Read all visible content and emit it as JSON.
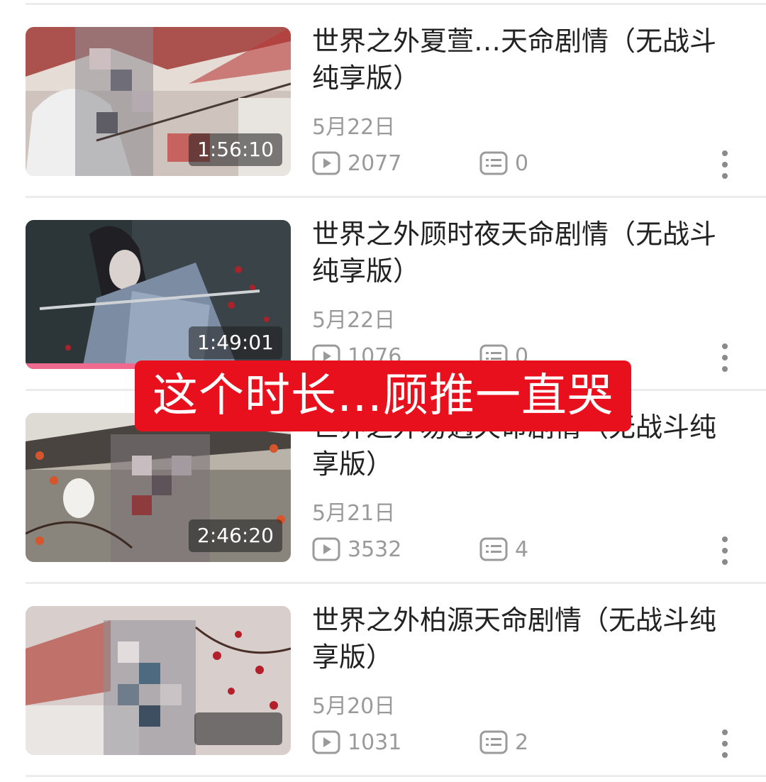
{
  "videos": [
    {
      "title": "世界之外夏萱…天命剧情（无战斗纯享版）",
      "duration": "1:56:10",
      "date": "5月22日",
      "views": "2077",
      "comments": "0",
      "progress": 0
    },
    {
      "title": "世界之外顾时夜天命剧情（无战斗纯享版）",
      "duration": "1:49:01",
      "date": "5月22日",
      "views": "1076",
      "comments": "0",
      "progress": 0.5
    },
    {
      "title": "世界之外易遇天命剧情（无战斗纯享版）",
      "duration": "2:46:20",
      "date": "5月21日",
      "views": "3532",
      "comments": "4",
      "progress": 0
    },
    {
      "title": "世界之外柏源天命剧情（无战斗纯享版）",
      "duration": "",
      "date": "5月20日",
      "views": "1031",
      "comments": "2",
      "progress": 0
    }
  ],
  "overlay_caption": "这个时长…顾推一直哭",
  "icons": {
    "views": "play-icon",
    "comments": "comment-icon",
    "more": "more-vertical-icon"
  },
  "colors": {
    "caption_bg": "#e8101c",
    "progress": "#f06a8f",
    "meta_text": "#9a9a9a"
  }
}
